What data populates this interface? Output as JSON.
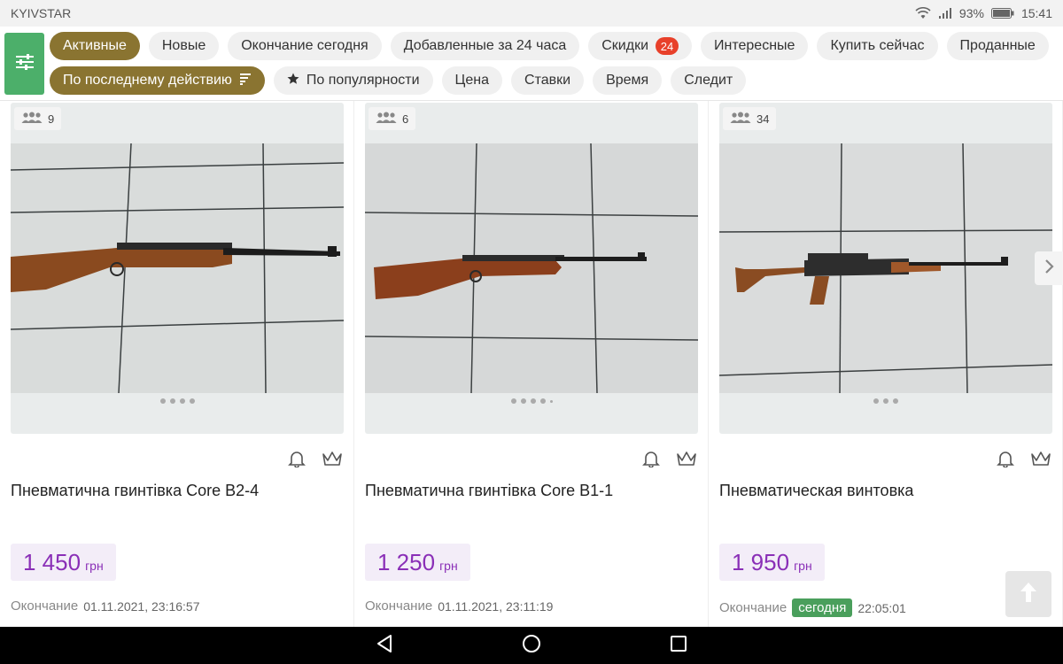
{
  "status_bar": {
    "carrier": "KYIVSTAR",
    "battery": "93%",
    "time": "15:41"
  },
  "filters": {
    "row1": [
      {
        "label": "Активные",
        "active": true
      },
      {
        "label": "Новые",
        "active": false
      },
      {
        "label": "Окончание сегодня",
        "active": false
      },
      {
        "label": "Добавленные за 24 часа",
        "active": false
      },
      {
        "label": "Скидки",
        "active": false,
        "badge": "24"
      },
      {
        "label": "Интересные",
        "active": false
      },
      {
        "label": "Купить сейчас",
        "active": false
      },
      {
        "label": "Проданные",
        "active": false
      }
    ],
    "sort": [
      {
        "label": "По последнему действию",
        "active": true,
        "icon": "sort-lines-icon"
      },
      {
        "label": "По популярности",
        "active": false,
        "icon": "star-icon"
      },
      {
        "label": "Цена",
        "active": false
      },
      {
        "label": "Ставки",
        "active": false
      },
      {
        "label": "Время",
        "active": false
      },
      {
        "label": "Следит",
        "active": false
      }
    ]
  },
  "lots": [
    {
      "bidders": "9",
      "title": "Пневматична гвинтівка Core B2-4",
      "price": "1 450",
      "currency": "грн",
      "ending_label": "Окончание",
      "ending_time": "01.11.2021, 23:16:57",
      "today_tag": "",
      "dots": 4,
      "extra_small_dot": false
    },
    {
      "bidders": "6",
      "title": "Пневматична гвинтівка Core B1-1",
      "price": "1 250",
      "currency": "грн",
      "ending_label": "Окончание",
      "ending_time": "01.11.2021, 23:11:19",
      "today_tag": "",
      "dots": 4,
      "extra_small_dot": true
    },
    {
      "bidders": "34",
      "title": "Пневматическая винтовка",
      "price": "1 950",
      "currency": "грн",
      "ending_label": "Окончание",
      "ending_time": "22:05:01",
      "today_tag": "сегодня",
      "dots": 3,
      "extra_small_dot": false
    }
  ],
  "colors": {
    "accent_active": "#8a7431",
    "filter_button": "#4caf6a",
    "price": "#8a2fb7",
    "discount_badge": "#e8402a",
    "today_tag": "#4a9f5c"
  }
}
